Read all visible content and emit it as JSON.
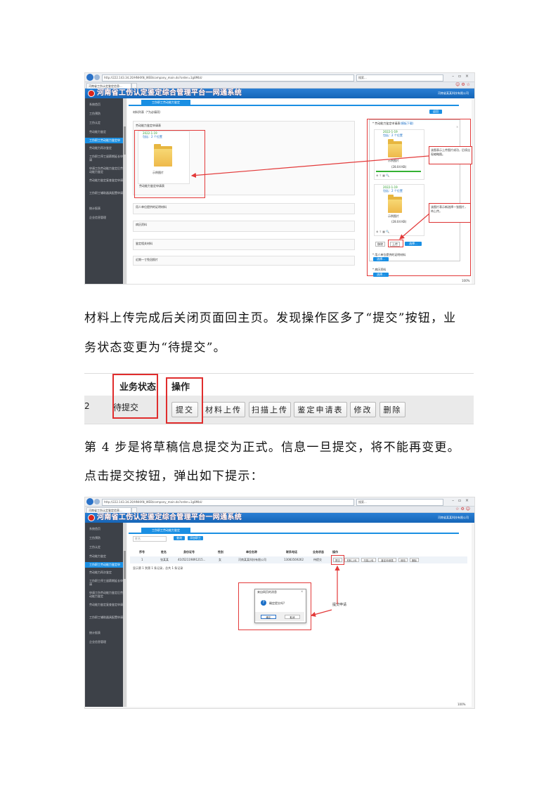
{
  "screenshot1": {
    "url": "http://222.143.34.20/HNHXN_WEB/company_main.do?order=1g8MbU",
    "search": "搜索...",
    "tab_title": "河南省工伤认定鉴定信息...",
    "app_title": "河南省工伤认定鉴定综合管理平台一网通系统",
    "company": "河南省某某科技有限公司",
    "sidebar": [
      "系统首页",
      "工伤预防",
      "工伤认定",
      "劳动能力鉴定",
      "工伤职工劳动能力鉴定申",
      "劳动能力再次鉴定",
      "工伤职工停工留薪期延长申请",
      "申请工伤劳动能力鉴定后劳动能力鉴定",
      "劳动能力鉴定复查鉴定申请",
      "工伤职工辅助器具配置申请",
      "统计报表",
      "企业信息管理"
    ],
    "page_tab": "工伤职工劳动能力鉴定",
    "materials_heading": "材料列表（*为必填项）",
    "back_btn": "返回",
    "sections": [
      "劳动能力鉴定申请表",
      "用人单位提供的证明材料",
      "病历资料",
      "鉴定相关材料",
      "近期一寸免冠照片"
    ],
    "left_card": {
      "date": "2022-1-19",
      "path": "包括：2 个位置",
      "caption": "示例图片",
      "file": "劳动能力鉴定申请表"
    },
    "right_panel_title": "* 劳动能力鉴定申请表",
    "right_panel_link": "(模板下载)",
    "right_cards": [
      {
        "date": "2022-1-19",
        "path": "包括：2 个位置",
        "caption": "示例图片",
        "size": "(28.04 KB)"
      },
      {
        "date": "2022-1-19",
        "path": "包括：2 个位置",
        "caption": "示例图片",
        "size": "(28.04 KB)"
      }
    ],
    "callout_1": "该图表示上传图片成功，后续出现缩略图。",
    "callout_2": "该图片表示新选择一张图片，待上传。",
    "delete_btn": "移除",
    "upload_btn": "上传",
    "choose_btn": "选择...",
    "extra_label_1": "* 用人单位提供的证明材料",
    "extra_label_2": "* 病历资料",
    "zoom": "100%"
  },
  "paragraph1": {
    "line1": "材料上传完成后关闭页面回主页。发现操作区多了“提交”按钮，业",
    "line2": "务状态变更为“待提交”。"
  },
  "strip": {
    "col_status": "业务状态",
    "col_ops": "操作",
    "row_num": "2",
    "status_value": "待提交",
    "buttons": [
      "提交",
      "材料上传",
      "扫描上传",
      "鉴定申请表",
      "修改",
      "删除"
    ]
  },
  "paragraph2": {
    "line1": "第 4 步是将草稿信息提交为正式。信息一旦提交，将不能再变更。",
    "line2": "点击提交按钮，弹出如下提示："
  },
  "screenshot2": {
    "url": "http://222.143.34.20/HNHXN_WEB/company_main.do?order=1g8MbU",
    "search": "搜索...",
    "tab_title": "河南省工伤认定鉴定信息...",
    "app_title": "河南省工伤认定鉴定综合管理平台一网通系统",
    "company": "河南省某某科技有限公司",
    "page_tab": "工伤职工劳动能力鉴定",
    "search_placeholder": "姓名",
    "query_btn": "查询",
    "add_btn": "添加职工",
    "headers": [
      "序号",
      "姓名",
      "身份证号",
      "性别",
      "单位名称",
      "联系电话",
      "业务状态",
      "操作"
    ],
    "row": [
      "1",
      "张某某",
      "41052119891215...",
      "女",
      "河南某某科技有限公司",
      "13083569262",
      "待提交"
    ],
    "row_buttons": [
      "提交",
      "材料上传",
      "扫描上传",
      "鉴定申请表",
      "修改",
      "删除"
    ],
    "pager": "显示第 1 到第 1 条记录，总共 1 条记录",
    "dialog_title": "来自网页的消息",
    "dialog_msg": "确定提交吗?",
    "dialog_ok": "确定",
    "dialog_cancel": "取消",
    "callout": "提交申请",
    "zoom": "100%"
  }
}
